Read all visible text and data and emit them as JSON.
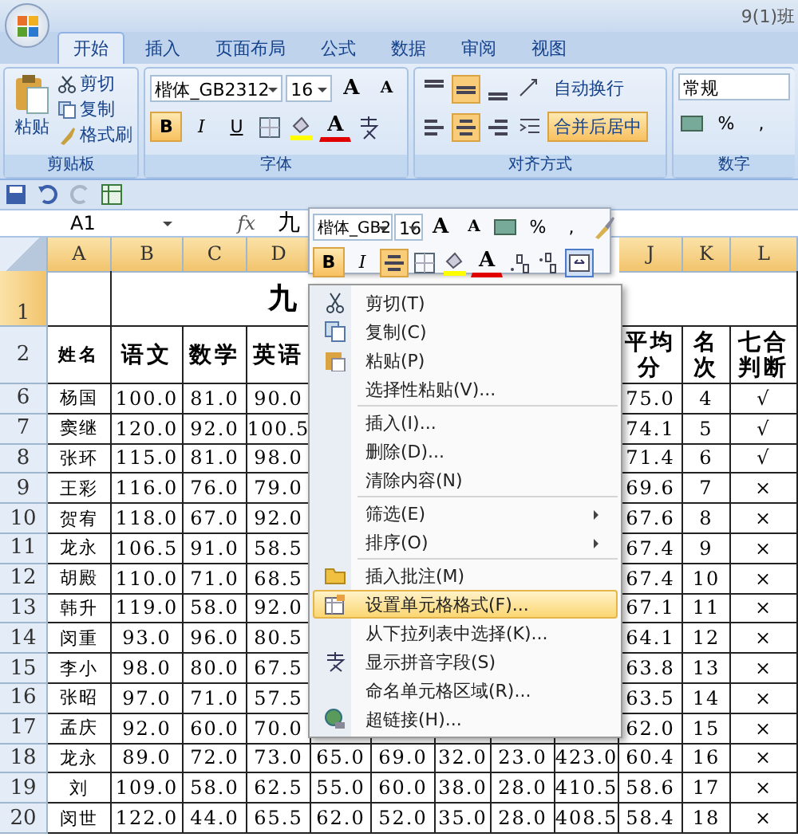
{
  "title_bar": {
    "title": "9(1)班"
  },
  "tabs": [
    {
      "label": "开始",
      "selected": true
    },
    {
      "label": "插入",
      "selected": false
    },
    {
      "label": "页面布局",
      "selected": false
    },
    {
      "label": "公式",
      "selected": false
    },
    {
      "label": "数据",
      "selected": false
    },
    {
      "label": "审阅",
      "selected": false
    },
    {
      "label": "视图",
      "selected": false
    }
  ],
  "ribbon": {
    "clipboard": {
      "label": "剪贴板",
      "paste": "粘贴",
      "items": [
        "剪切",
        "复制",
        "格式刷"
      ]
    },
    "font": {
      "label": "字体",
      "font_name": "楷体_GB2312",
      "font_size": "16",
      "grow": "A",
      "shrink": "A",
      "font_color_label": "A",
      "styles": [
        {
          "label": "B",
          "selected": true
        },
        {
          "label": "I",
          "selected": false
        },
        {
          "label": "U",
          "selected": false
        }
      ]
    },
    "alignment": {
      "label": "对齐方式",
      "vertical": [
        {
          "selected": false
        },
        {
          "selected": true
        },
        {
          "selected": false
        }
      ],
      "horizontal": [
        {
          "selected": false
        },
        {
          "selected": true
        },
        {
          "selected": false
        }
      ],
      "wrap": {
        "label": "自动换行",
        "selected": false
      },
      "merge": {
        "label": "合并后居中",
        "selected": true
      }
    },
    "number": {
      "label": "数字",
      "format": "常规",
      "percent": "%",
      "comma": ","
    }
  },
  "formula_bar": {
    "name_box": "A1",
    "fx": "fx",
    "value": "九"
  },
  "mini_toolbar": {
    "font_name": "楷体_GB2",
    "font_size": "16",
    "grow": "A",
    "shrink": "A",
    "percent": "%",
    "comma": ",",
    "font_color_label": "A",
    "bold": {
      "label": "B",
      "selected": true
    },
    "italic": {
      "label": "I",
      "selected": false
    },
    "center": {
      "selected": true
    },
    "merge": {
      "selected": true
    }
  },
  "sheet": {
    "columns": [
      {
        "letter": "A",
        "selected": true
      },
      {
        "letter": "B",
        "selected": true
      },
      {
        "letter": "C",
        "selected": true
      },
      {
        "letter": "D",
        "selected": true
      },
      {
        "letter": "J",
        "selected": true
      },
      {
        "letter": "K",
        "selected": true
      },
      {
        "letter": "L",
        "selected": true
      }
    ],
    "rows": [
      {
        "number": "1",
        "kind": "title",
        "selected": true,
        "cells": {
          "B": "九"
        }
      },
      {
        "number": "2",
        "kind": "header",
        "selected": false,
        "cells": {
          "A": "姓名",
          "B": "语文",
          "C": "数学",
          "D": "英语",
          "J": "平均分",
          "K": "名次",
          "L": "七合判断"
        }
      },
      {
        "number": "6",
        "kind": "data",
        "selected": false,
        "cells": {
          "A": "杨国",
          "B": "100.0",
          "C": "81.0",
          "D": "90.0",
          "J": "75.0",
          "K": "4",
          "L": "√"
        }
      },
      {
        "number": "7",
        "kind": "data",
        "selected": false,
        "cells": {
          "A": "窦继",
          "B": "120.0",
          "C": "92.0",
          "D": "100.5",
          "J": "74.1",
          "K": "5",
          "L": "√"
        }
      },
      {
        "number": "8",
        "kind": "data",
        "selected": false,
        "cells": {
          "A": "张环",
          "B": "115.0",
          "C": "81.0",
          "D": "98.0",
          "J": "71.4",
          "K": "6",
          "L": "√"
        }
      },
      {
        "number": "9",
        "kind": "data",
        "selected": false,
        "cells": {
          "A": "王彩",
          "B": "116.0",
          "C": "76.0",
          "D": "79.0",
          "J": "69.6",
          "K": "7",
          "L": "×"
        }
      },
      {
        "number": "10",
        "kind": "data",
        "selected": false,
        "cells": {
          "A": "贺宥",
          "B": "118.0",
          "C": "67.0",
          "D": "92.0",
          "J": "67.6",
          "K": "8",
          "L": "×"
        }
      },
      {
        "number": "11",
        "kind": "data",
        "selected": false,
        "cells": {
          "A": "龙永",
          "B": "106.5",
          "C": "91.0",
          "D": "58.5",
          "J": "67.4",
          "K": "9",
          "L": "×"
        }
      },
      {
        "number": "12",
        "kind": "data",
        "selected": false,
        "cells": {
          "A": "胡殿",
          "B": "110.0",
          "C": "71.0",
          "D": "68.5",
          "J": "67.4",
          "K": "10",
          "L": "×"
        }
      },
      {
        "number": "13",
        "kind": "data",
        "selected": false,
        "cells": {
          "A": "韩升",
          "B": "119.0",
          "C": "58.0",
          "D": "92.0",
          "J": "67.1",
          "K": "11",
          "L": "×"
        }
      },
      {
        "number": "14",
        "kind": "data",
        "selected": false,
        "cells": {
          "A": "闵重",
          "B": "93.0",
          "C": "96.0",
          "D": "80.5",
          "J": "64.1",
          "K": "12",
          "L": "×"
        }
      },
      {
        "number": "15",
        "kind": "data",
        "selected": false,
        "cells": {
          "A": "李小",
          "B": "98.0",
          "C": "80.0",
          "D": "67.5",
          "J": "63.8",
          "K": "13",
          "L": "×"
        }
      },
      {
        "number": "16",
        "kind": "data",
        "selected": false,
        "cells": {
          "A": "张昭",
          "B": "97.0",
          "C": "71.0",
          "D": "57.5",
          "J": "63.5",
          "K": "14",
          "L": "×"
        }
      },
      {
        "number": "17",
        "kind": "data",
        "selected": false,
        "cells": {
          "A": "孟庆",
          "B": "92.0",
          "C": "60.0",
          "D": "70.0",
          "J": "62.0",
          "K": "15",
          "L": "×"
        }
      },
      {
        "number": "18",
        "kind": "data",
        "selected": false,
        "cells": {
          "A": "龙永",
          "B": "89.0",
          "C": "72.0",
          "D": "73.0",
          "E": "65.0",
          "F": "69.0",
          "G": "32.0",
          "H": "23.0",
          "I": "423.0",
          "J": "60.4",
          "K": "16",
          "L": "×"
        }
      },
      {
        "number": "19",
        "kind": "data",
        "selected": false,
        "cells": {
          "A": "刘",
          "B": "109.0",
          "C": "58.0",
          "D": "62.5",
          "E": "55.0",
          "F": "60.0",
          "G": "38.0",
          "H": "28.0",
          "I": "410.5",
          "J": "58.6",
          "K": "17",
          "L": "×"
        }
      },
      {
        "number": "20",
        "kind": "data",
        "selected": false,
        "cells": {
          "A": "闵世",
          "B": "122.0",
          "C": "44.0",
          "D": "65.5",
          "E": "62.0",
          "F": "52.0",
          "G": "35.0",
          "H": "28.0",
          "I": "408.5",
          "J": "58.4",
          "K": "18",
          "L": "×"
        }
      }
    ]
  },
  "context_menu": {
    "items": [
      {
        "kind": "item",
        "label": "剪切(T)",
        "selected": false
      },
      {
        "kind": "item",
        "label": "复制(C)",
        "selected": false
      },
      {
        "kind": "item",
        "label": "粘贴(P)",
        "selected": false
      },
      {
        "kind": "item",
        "label": "选择性粘贴(V)...",
        "selected": false
      },
      {
        "kind": "separator"
      },
      {
        "kind": "item",
        "label": "插入(I)...",
        "selected": false
      },
      {
        "kind": "item",
        "label": "删除(D)...",
        "selected": false
      },
      {
        "kind": "item",
        "label": "清除内容(N)",
        "selected": false
      },
      {
        "kind": "separator"
      },
      {
        "kind": "submenu",
        "label": "筛选(E)",
        "selected": false
      },
      {
        "kind": "submenu",
        "label": "排序(O)",
        "selected": false
      },
      {
        "kind": "separator"
      },
      {
        "kind": "item",
        "label": "插入批注(M)",
        "selected": false
      },
      {
        "kind": "item",
        "label": "设置单元格格式(F)...",
        "selected": true
      },
      {
        "kind": "item",
        "label": "从下拉列表中选择(K)...",
        "selected": false
      },
      {
        "kind": "item",
        "label": "显示拼音字段(S)",
        "selected": false
      },
      {
        "kind": "item",
        "label": "命名单元格区域(R)...",
        "selected": false
      },
      {
        "kind": "item",
        "label": "超链接(H)...",
        "selected": false
      }
    ]
  }
}
